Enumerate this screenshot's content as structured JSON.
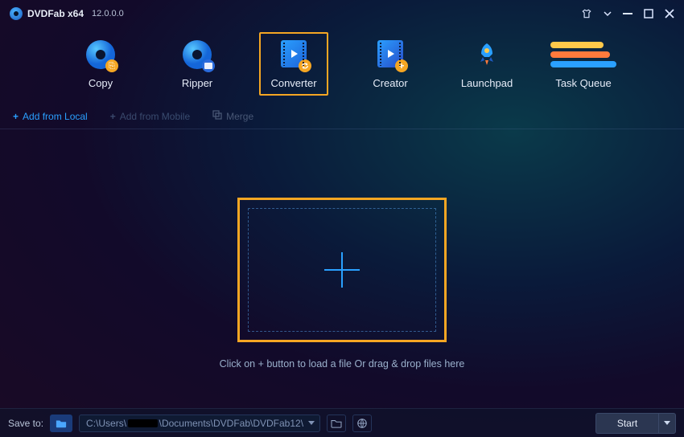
{
  "app": {
    "name": "DVDFab x64",
    "version": "12.0.0.0"
  },
  "modules": [
    {
      "label": "Copy",
      "selected": false
    },
    {
      "label": "Ripper",
      "selected": false
    },
    {
      "label": "Converter",
      "selected": true
    },
    {
      "label": "Creator",
      "selected": false
    },
    {
      "label": "Launchpad",
      "selected": false
    },
    {
      "label": "Task Queue",
      "selected": false
    }
  ],
  "subbar": {
    "add_local": "Add from Local",
    "add_mobile": "Add from Mobile",
    "merge": "Merge"
  },
  "drop_hint": "Click on + button to load a file Or drag & drop files here",
  "footer": {
    "save_to_label": "Save to:",
    "path_prefix": "C:\\Users\\",
    "path_suffix": "\\Documents\\DVDFab\\DVDFab12\\",
    "start_label": "Start"
  }
}
